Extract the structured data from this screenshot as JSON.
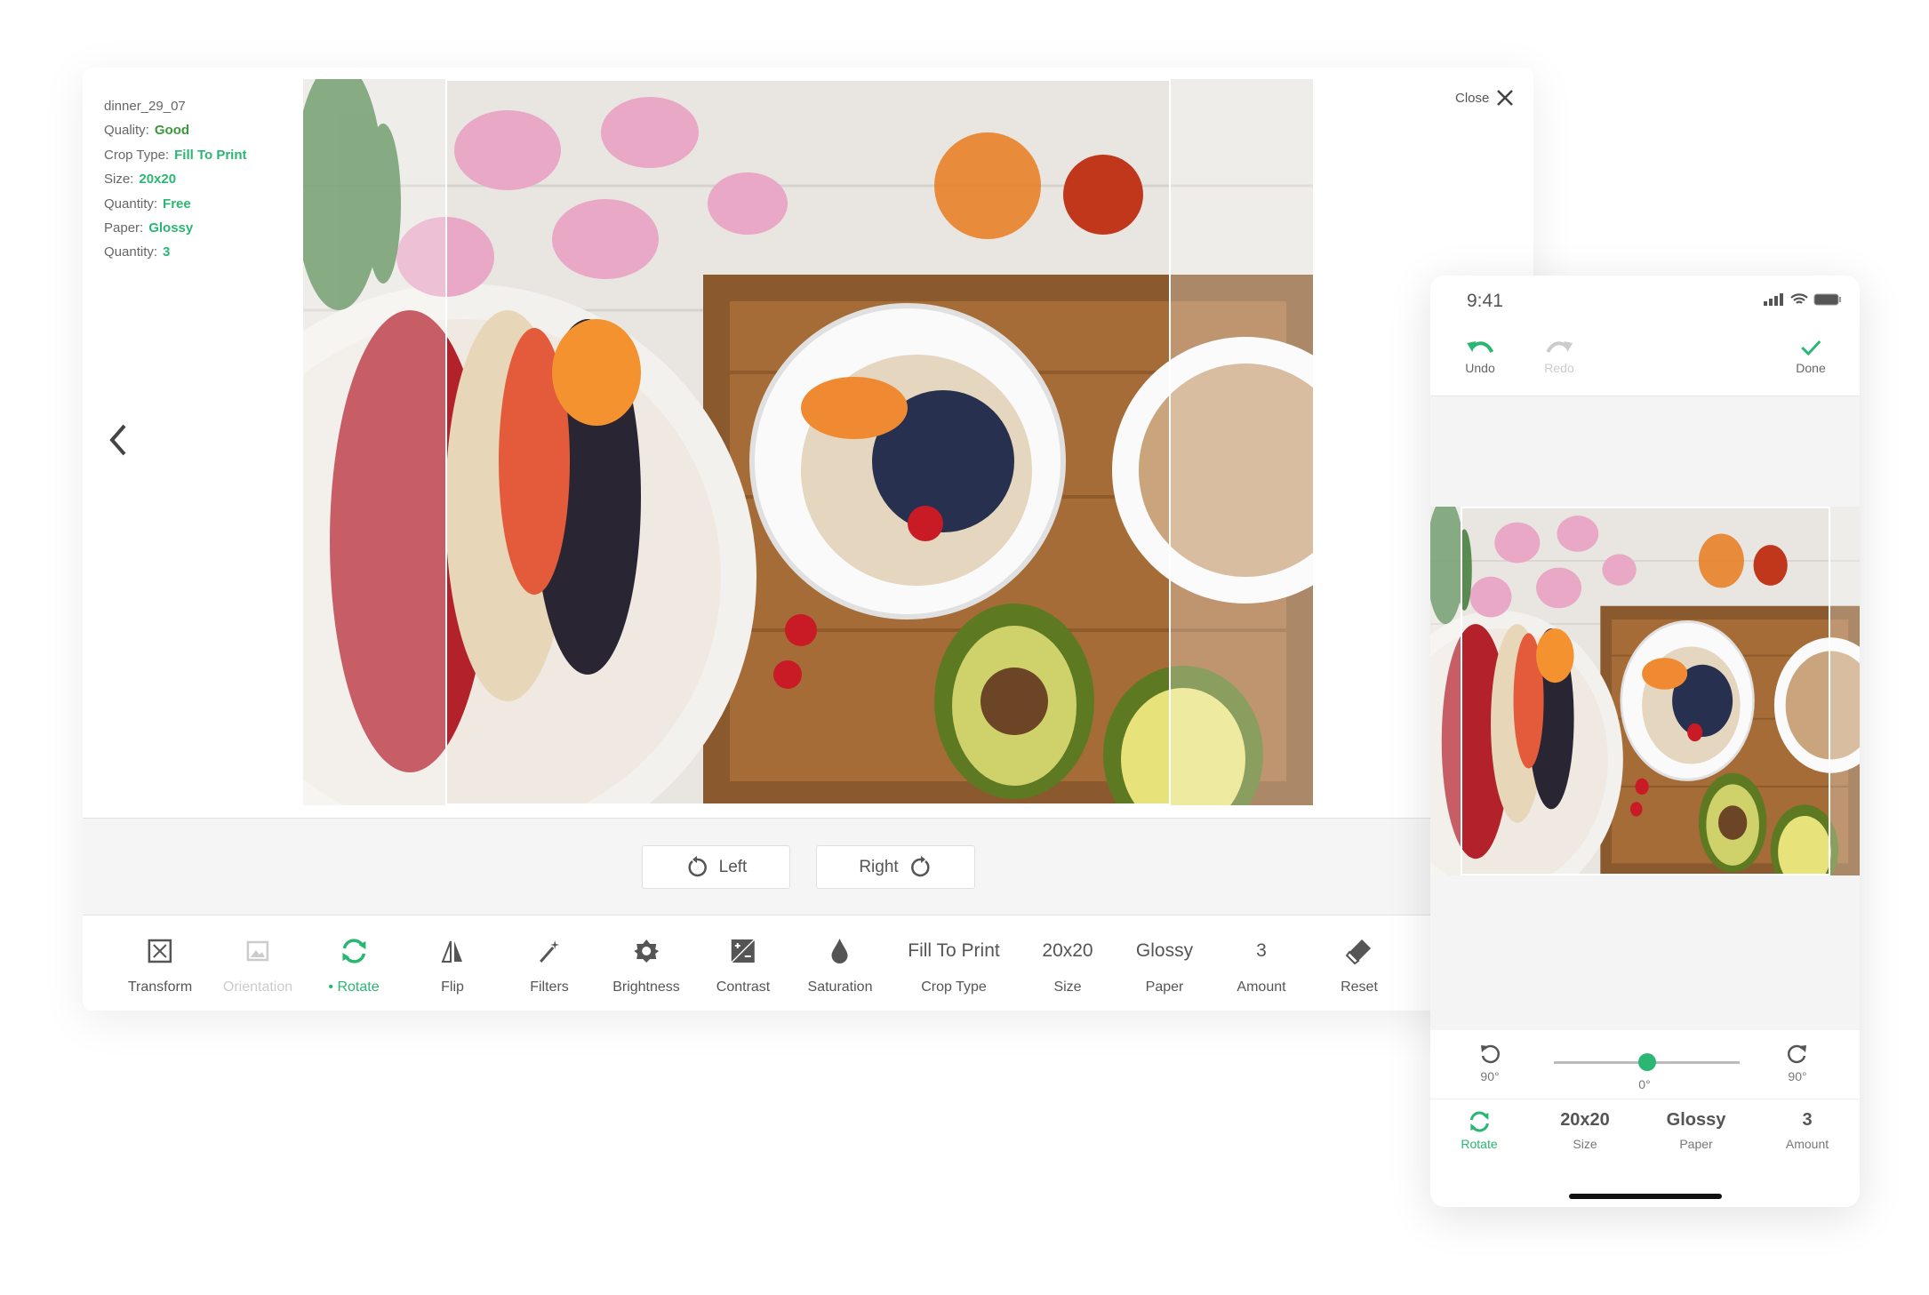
{
  "colors": {
    "accent": "#2bb673",
    "quality_good": "#3a9a3a"
  },
  "info": {
    "filename": "dinner_29_07",
    "rows": [
      {
        "label": "Quality:",
        "value": "Good"
      },
      {
        "label": "Crop Type:",
        "value": "Fill To Print"
      },
      {
        "label": "Size:",
        "value": "20x20"
      },
      {
        "label": "Quantity:",
        "value": "Free"
      },
      {
        "label": "Paper:",
        "value": "Glossy"
      },
      {
        "label": "Quantity:",
        "value": "3"
      }
    ]
  },
  "close_label": "Close",
  "rotate_buttons": {
    "left": "Left",
    "right": "Right"
  },
  "toolbar": [
    {
      "icon": "transform-icon",
      "label": "Transform"
    },
    {
      "icon": "orientation-icon",
      "label": "Orientation",
      "disabled": true
    },
    {
      "icon": "rotate-icon",
      "label": "• Rotate",
      "active": true
    },
    {
      "icon": "flip-icon",
      "label": "Flip"
    },
    {
      "icon": "magic-wand-icon",
      "label": "Filters"
    },
    {
      "icon": "brightness-icon",
      "label": "Brightness"
    },
    {
      "icon": "contrast-icon",
      "label": "Contrast"
    },
    {
      "icon": "droplet-icon",
      "label": "Saturation"
    },
    {
      "value": "Fill To Print",
      "label": "Crop Type"
    },
    {
      "value": "20x20",
      "label": "Size"
    },
    {
      "value": "Glossy",
      "label": "Paper"
    },
    {
      "value": "3",
      "label": "Amount"
    },
    {
      "icon": "eraser-icon",
      "label": "Reset"
    }
  ],
  "phone": {
    "time": "9:41",
    "undo": "Undo",
    "redo": "Redo",
    "done": "Done",
    "slider": {
      "left_label": "90°",
      "value_label": "0°",
      "right_label": "90°",
      "value": 0
    },
    "nav": [
      {
        "label": "Rotate",
        "icon": "rotate-icon",
        "active": true
      },
      {
        "value": "20x20",
        "label": "Size"
      },
      {
        "value": "Glossy",
        "label": "Paper"
      },
      {
        "value": "3",
        "label": "Amount"
      }
    ]
  }
}
